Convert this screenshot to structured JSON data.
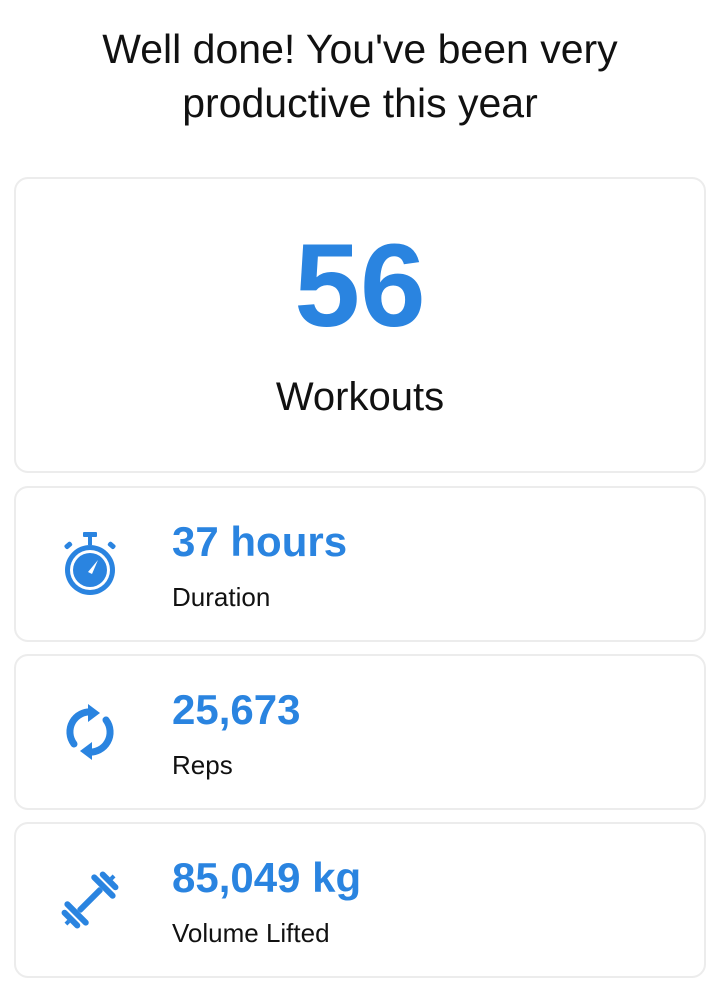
{
  "header": {
    "title_line1": "Well done! You've been very",
    "title_line2": "productive this year"
  },
  "summary": {
    "value": "56",
    "label": "Workouts"
  },
  "stats": [
    {
      "icon": "stopwatch-icon",
      "value": "37 hours",
      "label": "Duration"
    },
    {
      "icon": "refresh-icon",
      "value": "25,673",
      "label": "Reps"
    },
    {
      "icon": "dumbbell-icon",
      "value": "85,049 kg",
      "label": "Volume Lifted"
    }
  ],
  "colors": {
    "accent": "#2a84e0",
    "border": "#ececec"
  }
}
